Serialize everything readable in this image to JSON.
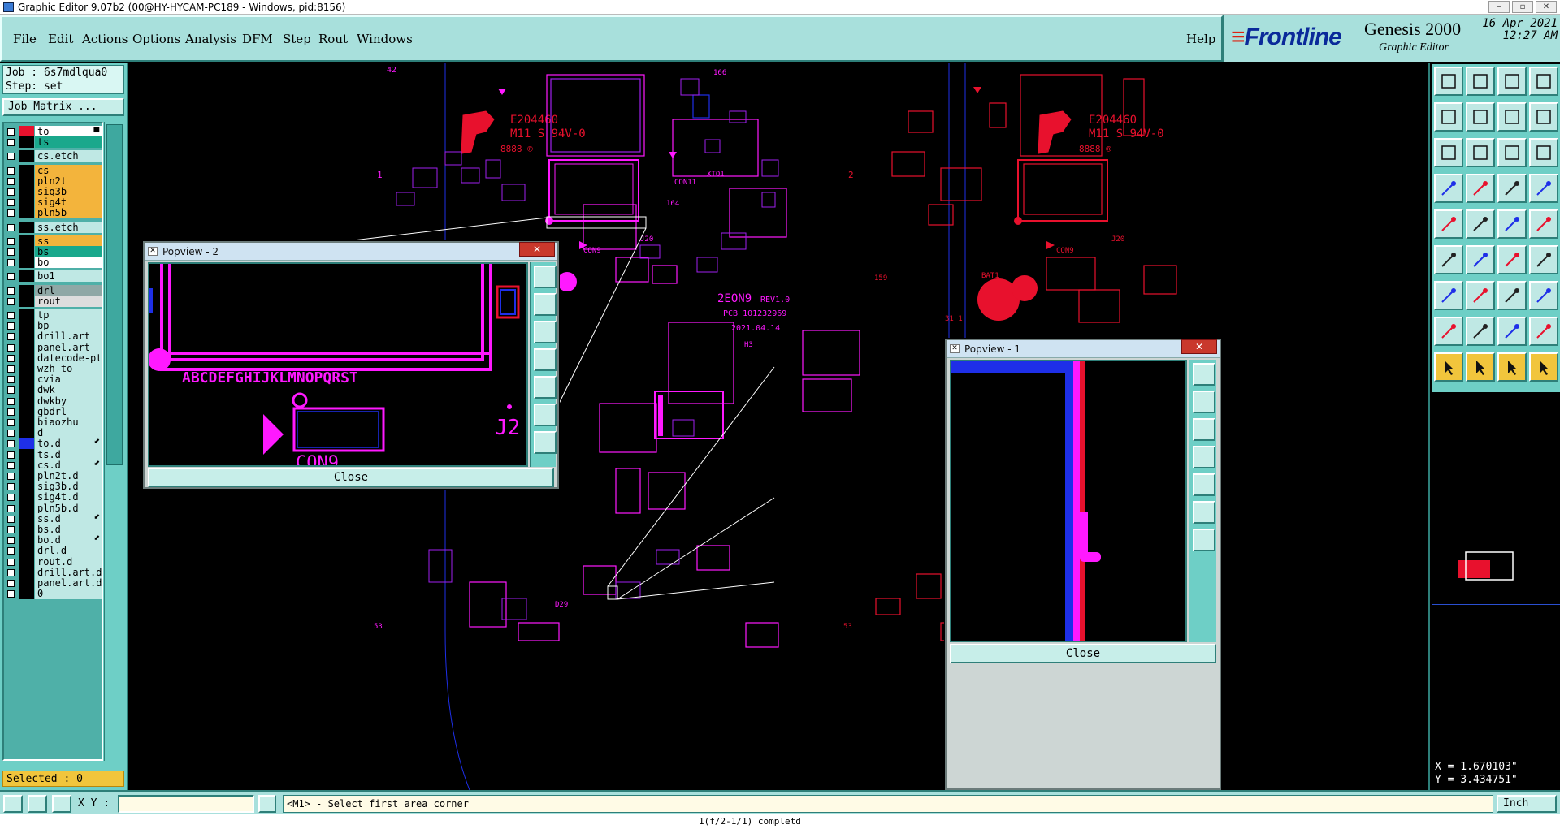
{
  "window": {
    "title": "Graphic Editor 9.07b2 (00@HY-HYCAM-PC189 - Windows, pid:8156)",
    "controls": [
      "–",
      "▫",
      "✕"
    ]
  },
  "menu": {
    "items": [
      "File",
      "Edit",
      "Actions",
      "Options",
      "Analysis",
      "DFM",
      "Step",
      "Rout",
      "Windows"
    ],
    "help": "Help"
  },
  "brand": {
    "logo": "Frontline",
    "product": "Genesis 2000",
    "subtitle": "Graphic Editor",
    "date": "16 Apr 2021",
    "time": "12:27 AM"
  },
  "job": {
    "job_line": "Job : 6s7mdlqua0",
    "step_line": "Step: set",
    "matrix_button": "Job Matrix ..."
  },
  "layers": [
    {
      "name": "to",
      "swatch": "#e8112d",
      "bg": "#ffffff",
      "marker": "■",
      "check": "#ffffff",
      "arrow": "■"
    },
    {
      "name": "ts",
      "swatch": "#000000",
      "bg": "#1aa88c",
      "check": "#ffffff",
      "arrow": ""
    },
    {
      "name": "cs.etch",
      "swatch": "#000000",
      "bg": "#bfe8e4",
      "check": "#ffffff",
      "arrow": "",
      "gap": true
    },
    {
      "name": "cs",
      "swatch": "#000000",
      "bg": "#f3b43c",
      "check": "#ffffff",
      "arrow": "",
      "gap": true
    },
    {
      "name": "pln2t",
      "swatch": "#000000",
      "bg": "#f3b43c",
      "check": "#ffffff",
      "arrow": ""
    },
    {
      "name": "sig3b",
      "swatch": "#000000",
      "bg": "#f3b43c",
      "check": "#ffffff",
      "arrow": ""
    },
    {
      "name": "sig4t",
      "swatch": "#000000",
      "bg": "#f3b43c",
      "check": "#ffffff",
      "arrow": ""
    },
    {
      "name": "pln5b",
      "swatch": "#000000",
      "bg": "#f3b43c",
      "check": "#ffffff",
      "arrow": ""
    },
    {
      "name": "ss.etch",
      "swatch": "#000000",
      "bg": "#bfe8e4",
      "check": "#ffffff",
      "arrow": "",
      "gap": true
    },
    {
      "name": "ss",
      "swatch": "#000000",
      "bg": "#f3b43c",
      "check": "#ffffff",
      "arrow": "",
      "gap": true
    },
    {
      "name": "bs",
      "swatch": "#000000",
      "bg": "#1aa88c",
      "check": "#ffffff",
      "arrow": ""
    },
    {
      "name": "bo",
      "swatch": "#000000",
      "bg": "#ffffff",
      "check": "#ffffff",
      "arrow": ""
    },
    {
      "name": "bo1",
      "swatch": "#000000",
      "bg": "#bfe8e4",
      "check": "#ffffff",
      "arrow": "",
      "gap": true
    },
    {
      "name": "drl",
      "swatch": "#000000",
      "bg": "#8fa8a6",
      "check": "#ffffff",
      "arrow": "",
      "gap": true
    },
    {
      "name": "rout",
      "swatch": "#000000",
      "bg": "#dddddd",
      "check": "#ffffff",
      "arrow": ""
    },
    {
      "name": "tp",
      "swatch": "#000000",
      "bg": "#bfe8e4",
      "check": "#ffffff",
      "arrow": "",
      "gap": true
    },
    {
      "name": "bp",
      "swatch": "#000000",
      "bg": "#bfe8e4",
      "check": "#ffffff",
      "arrow": ""
    },
    {
      "name": "drill.art",
      "swatch": "#000000",
      "bg": "#bfe8e4",
      "check": "#ffffff",
      "arrow": ""
    },
    {
      "name": "panel.art",
      "swatch": "#000000",
      "bg": "#bfe8e4",
      "check": "#ffffff",
      "arrow": ""
    },
    {
      "name": "datecode-pt",
      "swatch": "#000000",
      "bg": "#bfe8e4",
      "check": "#ffffff",
      "arrow": ""
    },
    {
      "name": "wzh-to",
      "swatch": "#000000",
      "bg": "#bfe8e4",
      "check": "#ffffff",
      "arrow": ""
    },
    {
      "name": "cvia",
      "swatch": "#000000",
      "bg": "#bfe8e4",
      "check": "#ffffff",
      "arrow": ""
    },
    {
      "name": "dwk",
      "swatch": "#000000",
      "bg": "#bfe8e4",
      "check": "#ffffff",
      "arrow": ""
    },
    {
      "name": "dwkby",
      "swatch": "#000000",
      "bg": "#bfe8e4",
      "check": "#ffffff",
      "arrow": ""
    },
    {
      "name": "gbdrl",
      "swatch": "#000000",
      "bg": "#bfe8e4",
      "check": "#ffffff",
      "arrow": ""
    },
    {
      "name": "biaozhu",
      "swatch": "#000000",
      "bg": "#bfe8e4",
      "check": "#ffffff",
      "arrow": ""
    },
    {
      "name": "d",
      "swatch": "#000000",
      "bg": "#bfe8e4",
      "check": "#ffffff",
      "arrow": ""
    },
    {
      "name": "to.d",
      "swatch": "#1e2fe8",
      "bg": "#bfe8e4",
      "check": "#ffffff",
      "arrow": "⬋"
    },
    {
      "name": "ts.d",
      "swatch": "#000000",
      "bg": "#bfe8e4",
      "check": "#ffffff",
      "arrow": ""
    },
    {
      "name": "cs.d",
      "swatch": "#000000",
      "bg": "#bfe8e4",
      "check": "#ffffff",
      "arrow": "⬋"
    },
    {
      "name": "pln2t.d",
      "swatch": "#000000",
      "bg": "#bfe8e4",
      "check": "#ffffff",
      "arrow": ""
    },
    {
      "name": "sig3b.d",
      "swatch": "#000000",
      "bg": "#bfe8e4",
      "check": "#ffffff",
      "arrow": ""
    },
    {
      "name": "sig4t.d",
      "swatch": "#000000",
      "bg": "#bfe8e4",
      "check": "#ffffff",
      "arrow": ""
    },
    {
      "name": "pln5b.d",
      "swatch": "#000000",
      "bg": "#bfe8e4",
      "check": "#ffffff",
      "arrow": ""
    },
    {
      "name": "ss.d",
      "swatch": "#000000",
      "bg": "#bfe8e4",
      "check": "#ffffff",
      "arrow": "⬋"
    },
    {
      "name": "bs.d",
      "swatch": "#000000",
      "bg": "#bfe8e4",
      "check": "#ffffff",
      "arrow": ""
    },
    {
      "name": "bo.d",
      "swatch": "#000000",
      "bg": "#bfe8e4",
      "check": "#ffffff",
      "arrow": "⬋"
    },
    {
      "name": "drl.d",
      "swatch": "#000000",
      "bg": "#bfe8e4",
      "check": "#ffffff",
      "arrow": ""
    },
    {
      "name": "rout.d",
      "swatch": "#000000",
      "bg": "#bfe8e4",
      "check": "#ffffff",
      "arrow": ""
    },
    {
      "name": "drill.art.d",
      "swatch": "#000000",
      "bg": "#bfe8e4",
      "check": "#ffffff",
      "arrow": ""
    },
    {
      "name": "panel.art.d",
      "swatch": "#000000",
      "bg": "#bfe8e4",
      "check": "#ffffff",
      "arrow": ""
    },
    {
      "name": "0",
      "swatch": "#000000",
      "bg": "#bfe8e4",
      "check": "#ffffff",
      "arrow": ""
    }
  ],
  "selected": "Selected : 0",
  "canvas": {
    "labels": {
      "ul_left": "E204460",
      "ul_left2": "M11 S 94V-0",
      "ul_right": "E204460",
      "ul_right2": "M11 S 94V-0",
      "board": "2EON9",
      "rev": "REV1.0",
      "pcb": "PCB 101232969",
      "date": "2021.04.14",
      "h3": "H3",
      "con9": "CON9",
      "con9r": "CON9",
      "j20": "J20",
      "j20r": "J20",
      "n1": "1",
      "n2": "2",
      "bat1": "BAT1",
      "n42": "42",
      "n166": "166",
      "n159": "159",
      "d29": "D29",
      "con11": "CON11",
      "xto1": "XTO1",
      "n164": "164",
      "n53a": "53",
      "n53b": "53",
      "n31_1": "31_1"
    },
    "colors": {
      "top": "#e8112d",
      "magenta": "#ff19ff",
      "violet": "#a020f0",
      "blue": "#1e2fe8"
    }
  },
  "popview2": {
    "title": "Popview - 2",
    "close_label": "Close",
    "text_j2": "J2",
    "text_con9": "CON9",
    "text_letters": "ABCDEFGHIJKLMNOPQRST"
  },
  "popview1": {
    "title": "Popview - 1",
    "close_label": "Close"
  },
  "tools": {
    "rows": 9,
    "cols": 4
  },
  "coords": {
    "x": "X = 1.670103\"",
    "y": "Y = 3.434751\""
  },
  "status": {
    "xy_label": "X Y :",
    "xy_value": "",
    "prompt": "<M1> - Select first area corner",
    "unit": "Inch"
  },
  "bottom_text": "1(f/2-1/1)        completd"
}
